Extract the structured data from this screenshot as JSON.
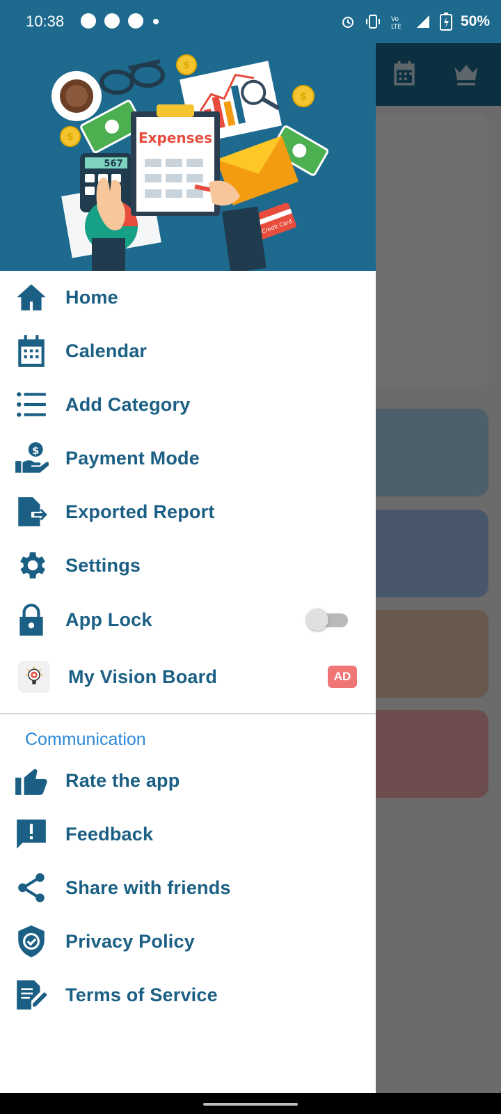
{
  "status_bar": {
    "time": "10:38",
    "battery": "50%",
    "icons": [
      "notification-p-icon",
      "gauge-icon",
      "gauge-icon",
      "dot-icon",
      "alarm-icon",
      "vibrate-icon",
      "volte-icon",
      "signal-icon",
      "battery-charging-icon"
    ]
  },
  "header": {
    "illustration_text": "Expenses",
    "calc_display": "567",
    "card_text": "Credit Card"
  },
  "menu": [
    {
      "label": "Home",
      "icon": "home-icon"
    },
    {
      "label": "Calendar",
      "icon": "calendar-icon"
    },
    {
      "label": "Add Category",
      "icon": "list-icon"
    },
    {
      "label": "Payment Mode",
      "icon": "hand-dollar-icon"
    },
    {
      "label": "Exported Report",
      "icon": "file-export-icon"
    },
    {
      "label": "Settings",
      "icon": "gear-icon"
    },
    {
      "label": "App Lock",
      "icon": "lock-icon",
      "toggle": false
    },
    {
      "label": "My Vision Board",
      "icon": "lightbulb-target-icon",
      "badge": "AD"
    }
  ],
  "communication": {
    "title": "Communication",
    "items": [
      {
        "label": "Rate the app",
        "icon": "thumbs-up-icon"
      },
      {
        "label": "Feedback",
        "icon": "feedback-icon"
      },
      {
        "label": "Share with friends",
        "icon": "share-icon"
      },
      {
        "label": "Privacy Policy",
        "icon": "shield-check-icon"
      },
      {
        "label": "Terms of Service",
        "icon": "document-edit-icon"
      }
    ]
  },
  "colors": {
    "primary": "#1d6a8e",
    "menu_text": "#1b5f84",
    "section_title": "#2b88d8",
    "ad_badge": "#f07676"
  },
  "background_app": {
    "toolbar_icons": [
      "calendar-icon",
      "crown-icon"
    ]
  }
}
